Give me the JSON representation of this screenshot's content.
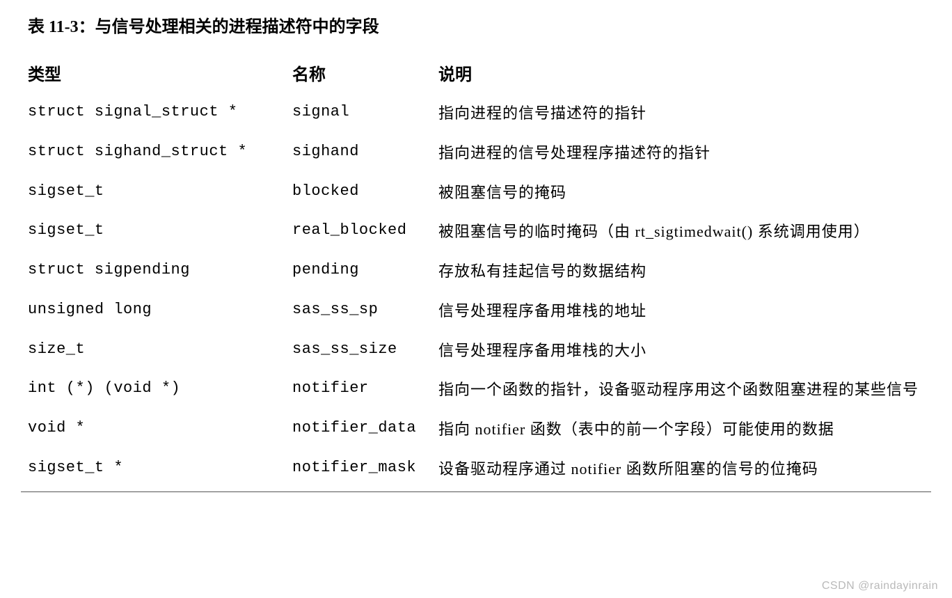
{
  "title": "表 11-3：与信号处理相关的进程描述符中的字段",
  "headers": {
    "type": "类型",
    "name": "名称",
    "desc": "说明"
  },
  "rows": [
    {
      "type": "struct signal_struct *",
      "name": "signal",
      "desc": "指向进程的信号描述符的指针"
    },
    {
      "type": "struct sighand_struct *",
      "name": "sighand",
      "desc": "指向进程的信号处理程序描述符的指针"
    },
    {
      "type": "sigset_t",
      "name": "blocked",
      "desc": "被阻塞信号的掩码"
    },
    {
      "type": "sigset_t",
      "name": "real_blocked",
      "desc": "被阻塞信号的临时掩码（由 rt_sigtimedwait() 系统调用使用）"
    },
    {
      "type": "struct sigpending",
      "name": "pending",
      "desc": "存放私有挂起信号的数据结构"
    },
    {
      "type": "unsigned long",
      "name": "sas_ss_sp",
      "desc": "信号处理程序备用堆栈的地址"
    },
    {
      "type": "size_t",
      "name": "sas_ss_size",
      "desc": "信号处理程序备用堆栈的大小"
    },
    {
      "type": "int (*) (void *)",
      "name": "notifier",
      "desc": "指向一个函数的指针，设备驱动程序用这个函数阻塞进程的某些信号"
    },
    {
      "type": "void *",
      "name": "notifier_data",
      "desc": "指向 notifier 函数（表中的前一个字段）可能使用的数据"
    },
    {
      "type": "sigset_t *",
      "name": "notifier_mask",
      "desc": "设备驱动程序通过 notifier 函数所阻塞的信号的位掩码"
    }
  ],
  "watermark": "CSDN @raindayinrain"
}
